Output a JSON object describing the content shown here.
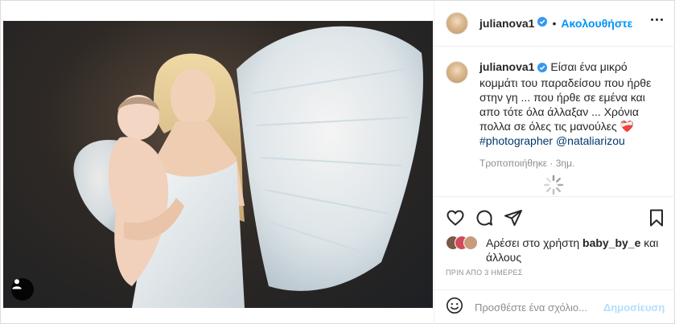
{
  "header": {
    "username": "julianova1",
    "separator": "•",
    "follow_label": "Ακολουθήστε"
  },
  "caption": {
    "username": "julianova1",
    "text": "Είσαι ένα μικρό κομμάτι του παραδείσου που ήρθε στην γη ... που ήρθε σε εμένα και απο τότε όλα άλλαξαν ... Χρόνια πολλα σε όλες τις μανούλες ",
    "heart": "❤️‍🩹",
    "hashtag": "#photographer",
    "mention": "@nataliarizou",
    "edited": "Τροποποιήθηκε · 3ημ."
  },
  "likes": {
    "prefix": "Αρέσει στο χρήστη ",
    "user": "baby_by_e",
    "suffix": " και άλλους"
  },
  "timestamp": "ΠΡΙΝ ΑΠΟ 3 ΗΜΕΡΕΣ",
  "comment": {
    "placeholder": "Προσθέστε ένα σχόλιο...",
    "post_label": "Δημοσίευση"
  },
  "icons": {
    "more": "more-options-icon",
    "like": "heart-icon",
    "comment": "comment-icon",
    "share": "share-icon",
    "save": "bookmark-icon",
    "emoji": "emoji-icon",
    "user_tag": "user-tag-icon",
    "verified": "verified-badge-icon",
    "loading": "spinner-icon"
  },
  "colors": {
    "accent": "#0095f6",
    "verified": "#3897f0",
    "link": "#00376b",
    "muted": "#8e8e8e",
    "post_disabled": "#b2dffc"
  }
}
